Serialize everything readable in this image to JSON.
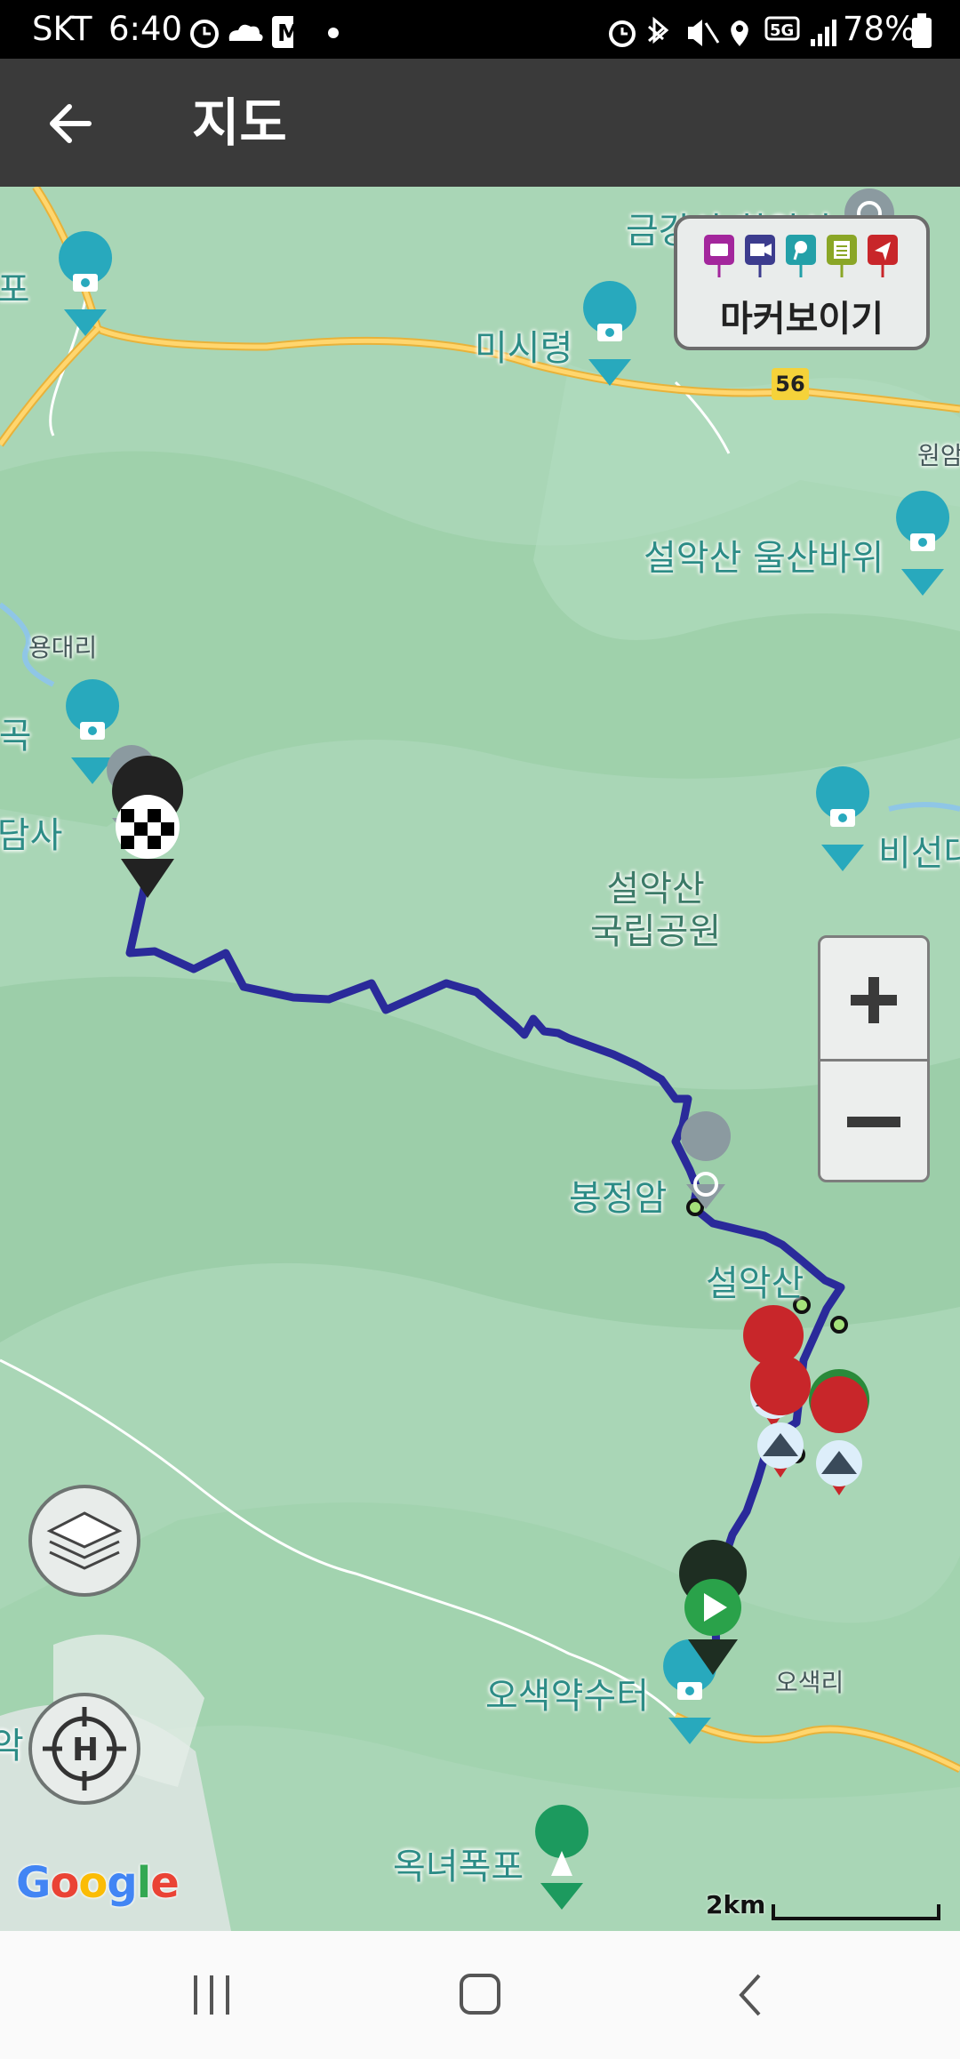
{
  "status_bar": {
    "carrier": "SKT",
    "time": "6:40",
    "network": "5G",
    "battery": "78%",
    "icons": [
      "alarm-icon",
      "cloud-icon",
      "m-stock-icon",
      "dot-icon",
      "alarm-icon",
      "bluetooth-icon",
      "mute-icon",
      "location-icon",
      "5g-icon",
      "signal-icon",
      "battery-icon"
    ]
  },
  "app_bar": {
    "title": "지도",
    "back_icon": "arrow-left-icon"
  },
  "map": {
    "place_labels": {
      "geumgangsa": "금강사 화암사",
      "misiryeong": "미시령",
      "road_56": "56",
      "wonam": "원암",
      "ulsanbawi": "설악산 울산바위",
      "yongdae": "용대리",
      "gyegok": "계곡",
      "pokpo_left": "폭포",
      "baekdamsa": "백담사",
      "bisun": "비선대",
      "park": "설악산\n국립공원",
      "bongjeongam": "봉정암",
      "seorak": "설악산",
      "osaek_yaksu": "오색약수터",
      "osaekri": "오색리",
      "onyeo": "옥녀폭포",
      "left_cut": "악"
    },
    "marker_toggle": {
      "label": "마커보이기",
      "icons": [
        "camera-icon",
        "video-icon",
        "pin-icon",
        "note-icon",
        "arrow-icon"
      ]
    },
    "zoom": {
      "in": "+",
      "out": "−"
    },
    "scale": "2km",
    "attribution": "Google",
    "route": {
      "color": "#2a2a9a",
      "start": "start-flag",
      "end": "finish-flag"
    }
  },
  "nav_bar": {
    "recent": "recent-apps-icon",
    "home": "home-icon",
    "back": "back-icon"
  }
}
